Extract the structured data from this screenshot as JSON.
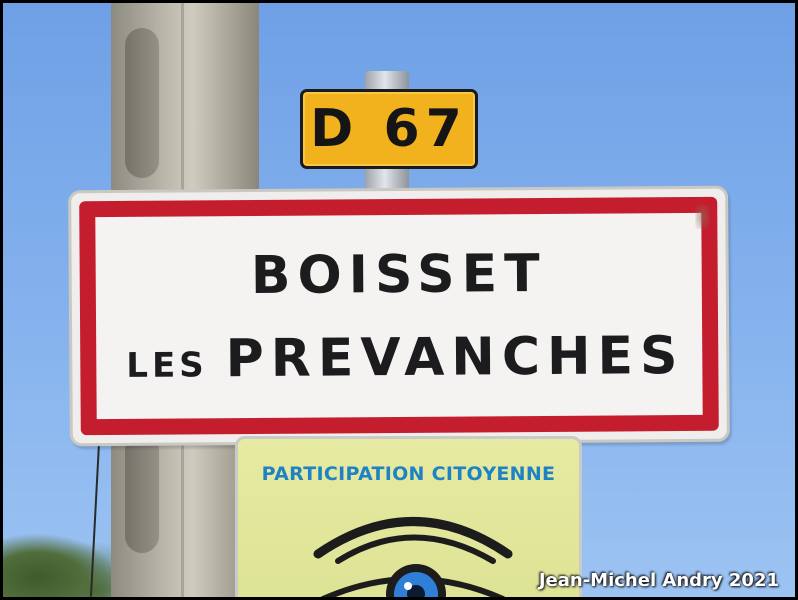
{
  "route_plate": {
    "text": "D 67",
    "color": "#f2b21e"
  },
  "town_sign": {
    "line1": "BOISSET",
    "line2_small": "LES",
    "line2_big": "PREVANCHES",
    "border_color": "#c41e2e"
  },
  "panel": {
    "title": "PARTICIPATION CITOYENNE",
    "title_color": "#1e82c4",
    "icon": "eye-icon"
  },
  "credit": "Jean-Michel Andry 2021",
  "sky_color": "#7aaaea"
}
